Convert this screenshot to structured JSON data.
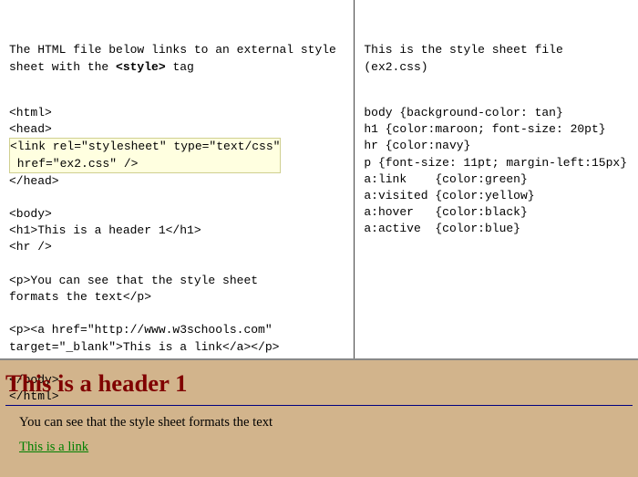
{
  "left": {
    "intro_prefix": "The HTML file below links to an external style sheet with the ",
    "intro_bold": "<style>",
    "intro_suffix": " tag",
    "line_html_open": "<html>",
    "line_head_open": "<head>",
    "highlight_l1": "<link rel=\"stylesheet\" type=\"text/css\"",
    "highlight_l2": " href=\"ex2.css\" />",
    "line_head_close": "</head>",
    "line_body_open": "<body>",
    "line_h1": "<h1>This is a header 1</h1>",
    "line_hr": "<hr />",
    "line_p1a": "<p>You can see that the style sheet",
    "line_p1b": "formats the text</p>",
    "line_p2a": "<p><a href=\"http://www.w3schools.com\"",
    "line_p2b": "target=\"_blank\">This is a link</a></p>",
    "line_body_close": "</body>",
    "line_html_close": "</html>"
  },
  "right": {
    "intro": "This is the style sheet file (ex2.css)",
    "l1": "body {background-color: tan}",
    "l2": "h1 {color:maroon; font-size: 20pt}",
    "l3": "hr {color:navy}",
    "l4": "p {font-size: 11pt; margin-left:15px}",
    "l5": "a:link    {color:green}",
    "l6": "a:visited {color:yellow}",
    "l7": "a:hover   {color:black}",
    "l8": "a:active  {color:blue}"
  },
  "preview": {
    "h1": "This is a header 1",
    "p1": "You can see that the style sheet formats the text",
    "link": "This is a link"
  }
}
